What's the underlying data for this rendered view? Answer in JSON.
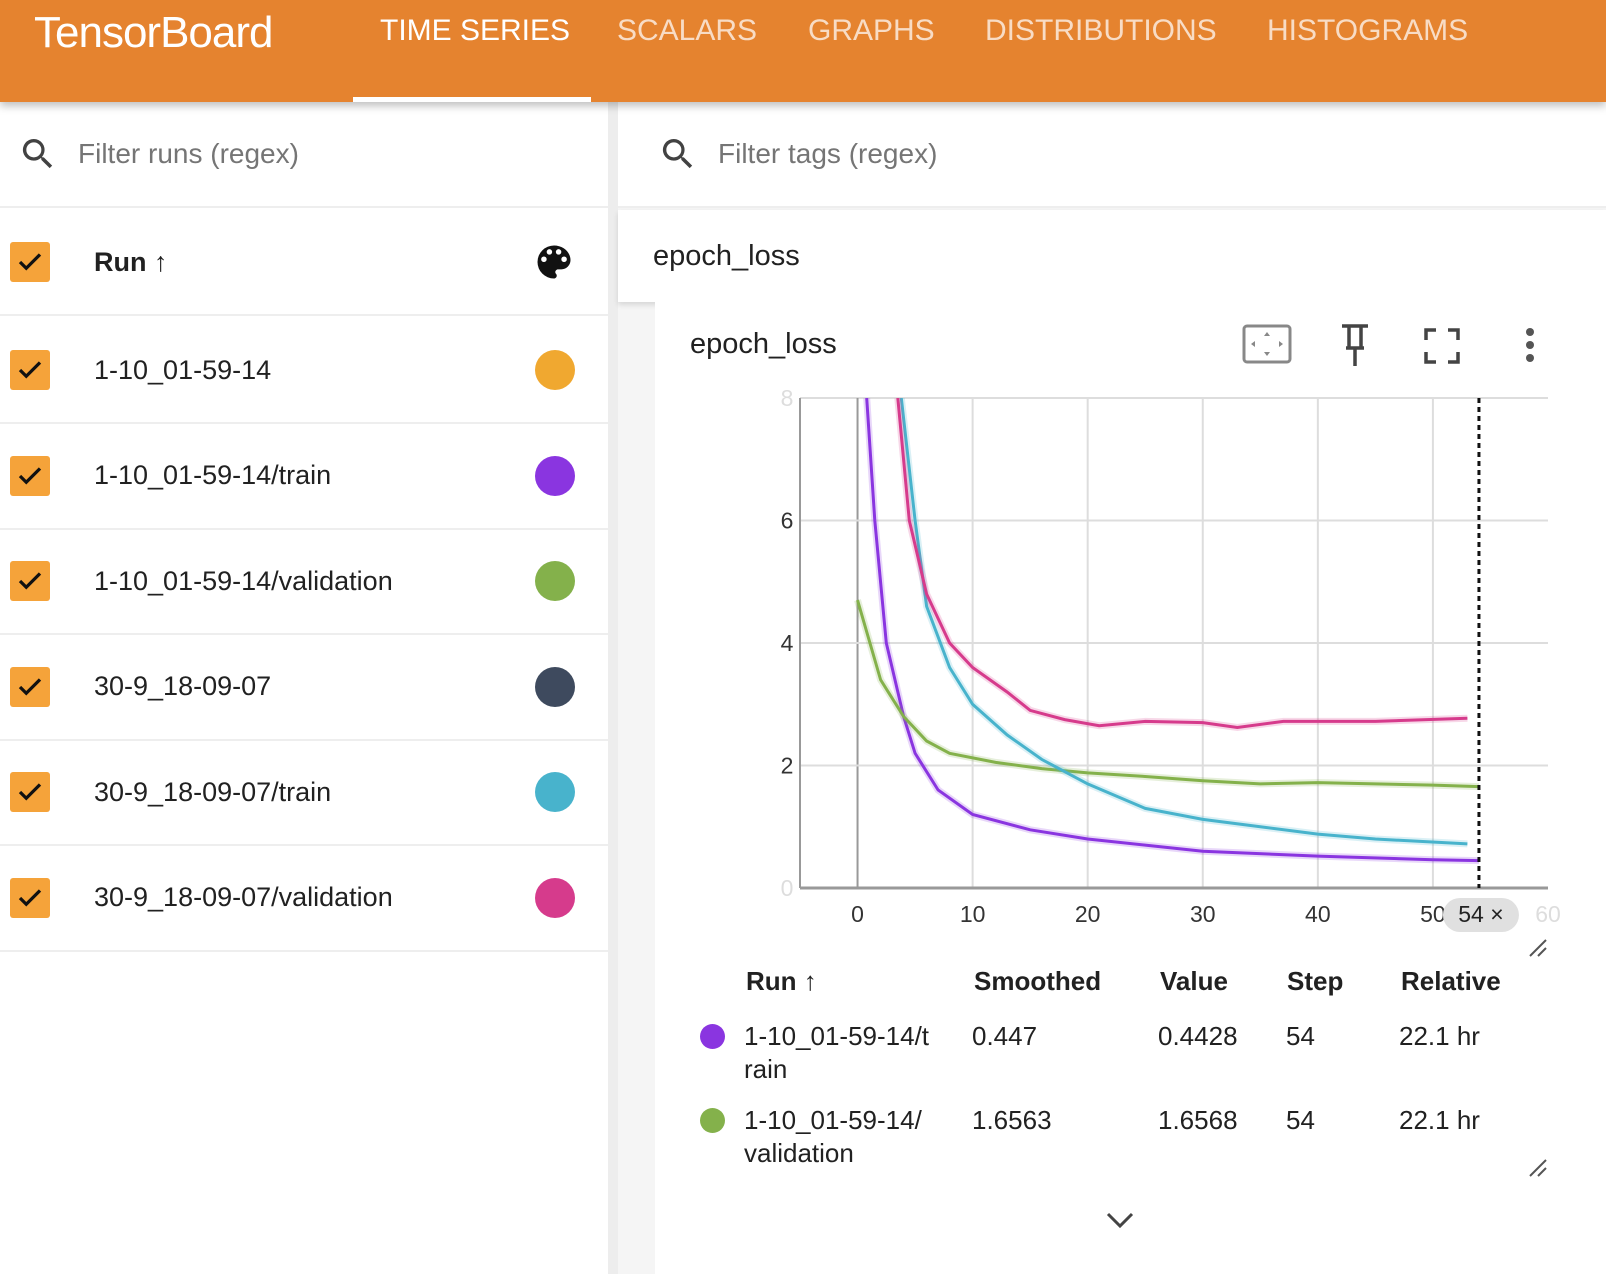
{
  "header": {
    "logo": "TensorBoard",
    "tabs": [
      {
        "label": "TIME SERIES",
        "active": true
      },
      {
        "label": "SCALARS"
      },
      {
        "label": "GRAPHS"
      },
      {
        "label": "DISTRIBUTIONS"
      },
      {
        "label": "HISTOGRAMS"
      }
    ],
    "color": "#E5832F"
  },
  "runs_panel": {
    "filter_placeholder": "Filter runs (regex)",
    "header_label": "Run ↑",
    "icons": [
      "search-icon",
      "palette-icon"
    ],
    "runs": [
      {
        "name": "1-10_01-59-14",
        "color": "#F0A830",
        "checked": true
      },
      {
        "name": "1-10_01-59-14/train",
        "color": "#8A35E0",
        "checked": true
      },
      {
        "name": "1-10_01-59-14/validation",
        "color": "#84B14B",
        "checked": true
      },
      {
        "name": "30-9_18-09-07",
        "color": "#3E4A5E",
        "checked": true
      },
      {
        "name": "30-9_18-09-07/train",
        "color": "#48B3CC",
        "checked": true
      },
      {
        "name": "30-9_18-09-07/validation",
        "color": "#D63B8C",
        "checked": true
      }
    ]
  },
  "main": {
    "filter_placeholder": "Filter tags (regex)",
    "tag_group": "epoch_loss",
    "card_title": "epoch_loss",
    "card_icons": [
      "fit-domain-icon",
      "pin-icon",
      "fullscreen-icon",
      "more-vert-icon"
    ],
    "cursor_label": "54 ×",
    "tooltip": {
      "columns": [
        "Run ↑",
        "Smoothed",
        "Value",
        "Step",
        "Relative"
      ],
      "rows": [
        {
          "run": "1-10_01-59-14/train",
          "color": "#8A35E0",
          "smoothed": "0.447",
          "value": "0.4428",
          "step": "54",
          "relative": "22.1 hr"
        },
        {
          "run": "1-10_01-59-14/validation",
          "color": "#84B14B",
          "smoothed": "1.6563",
          "value": "1.6568",
          "step": "54",
          "relative": "22.1 hr"
        }
      ]
    }
  },
  "chart_data": {
    "type": "line",
    "title": "epoch_loss",
    "xlim": [
      -5,
      60
    ],
    "ylim": [
      0,
      8
    ],
    "grid": true,
    "xticks": [
      "0",
      "10",
      "20",
      "30",
      "40",
      "50",
      "60"
    ],
    "yticks": [
      "0",
      "2",
      "4",
      "6",
      "8"
    ],
    "cursor_step": 54,
    "series": [
      {
        "name": "1-10_01-59-14/train",
        "color": "#8A35E0",
        "x": [
          0.8,
          1.5,
          2.5,
          4,
          5,
          7,
          10,
          15,
          20,
          25,
          30,
          40,
          50,
          54
        ],
        "y": [
          8,
          6,
          4,
          2.8,
          2.2,
          1.6,
          1.2,
          0.95,
          0.8,
          0.7,
          0.6,
          0.52,
          0.46,
          0.447
        ]
      },
      {
        "name": "1-10_01-59-14/validation",
        "color": "#84B14B",
        "x": [
          0,
          2,
          4,
          6,
          8,
          12,
          16,
          20,
          25,
          30,
          35,
          40,
          45,
          50,
          54
        ],
        "y": [
          4.7,
          3.4,
          2.8,
          2.4,
          2.2,
          2.05,
          1.95,
          1.88,
          1.82,
          1.75,
          1.7,
          1.72,
          1.7,
          1.68,
          1.656
        ]
      },
      {
        "name": "30-9_18-09-07/train",
        "color": "#48B3CC",
        "x": [
          3.8,
          5,
          6,
          8,
          10,
          13,
          16,
          20,
          25,
          30,
          35,
          40,
          45,
          53
        ],
        "y": [
          8,
          6,
          4.6,
          3.6,
          3.0,
          2.5,
          2.1,
          1.7,
          1.3,
          1.12,
          1.0,
          0.88,
          0.8,
          0.72
        ]
      },
      {
        "name": "30-9_18-09-07/validation",
        "color": "#D63B8C",
        "x": [
          3.5,
          4.5,
          6,
          8,
          10,
          13,
          15,
          18,
          21,
          25,
          30,
          33,
          37,
          45,
          53
        ],
        "y": [
          8,
          6,
          4.8,
          4.0,
          3.6,
          3.2,
          2.9,
          2.75,
          2.65,
          2.72,
          2.7,
          2.62,
          2.72,
          2.72,
          2.77
        ]
      }
    ]
  }
}
